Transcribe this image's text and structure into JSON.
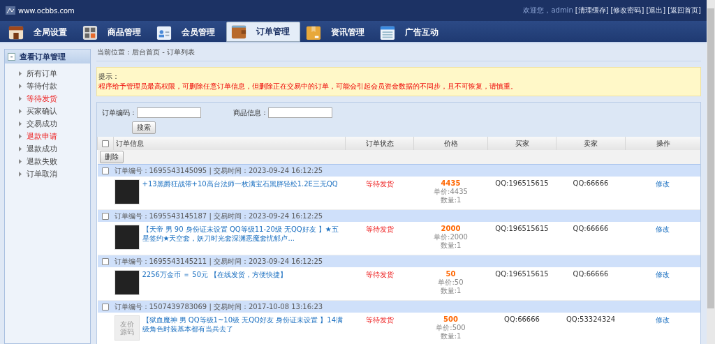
{
  "header": {
    "site": "www.ocbbs.com",
    "welcome": "欢迎您，admin",
    "links": [
      "[清理缓存]",
      "[修改密码]",
      "[退出]",
      "[返回首页]"
    ]
  },
  "tabs": [
    {
      "label": "全局设置",
      "selected": false
    },
    {
      "label": "商品管理",
      "selected": false
    },
    {
      "label": "会员管理",
      "selected": false
    },
    {
      "label": "订单管理",
      "selected": true
    },
    {
      "label": "资讯管理",
      "selected": false
    },
    {
      "label": "广告互动",
      "selected": false
    }
  ],
  "sidebar": {
    "title": "查看订单管理",
    "toggle": "-",
    "items": [
      {
        "label": "所有订单",
        "highlight": false
      },
      {
        "label": "等待付款",
        "highlight": false
      },
      {
        "label": "等待发货",
        "highlight": true
      },
      {
        "label": "买家确认",
        "highlight": false
      },
      {
        "label": "交易成功",
        "highlight": false
      },
      {
        "label": "退款申请",
        "highlight": true
      },
      {
        "label": "退款成功",
        "highlight": false
      },
      {
        "label": "退款失败",
        "highlight": false
      },
      {
        "label": "订单取消",
        "highlight": false
      }
    ]
  },
  "breadcrumb": "当前位置：后台首页 - 订单列表",
  "notice": {
    "title": "提示：",
    "text": "程序给予管理员最高权限，可删除任意订单信息，但删除正在交易中的订单，可能会引起会员资金数据的不同步，且不可恢复，请慎重。"
  },
  "search": {
    "fields": [
      {
        "label": "订单编码："
      },
      {
        "label": "商品信息："
      }
    ],
    "button": "搜索"
  },
  "table": {
    "select_all_checked": false,
    "columns": [
      "订单信息",
      "订单状态",
      "价格",
      "买家",
      "卖家",
      "操作"
    ],
    "delete_button": "删除",
    "rows": [
      {
        "header": "订单编号：1695543145095 | 交易时间：2023-09-24 16:12:25",
        "checked": false,
        "kind": "photo",
        "title": "+13黑爵狂战带+10高台法师一枚满宝石黑胖轻松1.2E三无QQ",
        "status": "等待发货",
        "price": "4435",
        "unit": "单价:4435",
        "qty": "数量:1",
        "buyer": "QQ:196515615",
        "seller": "QQ:66666",
        "action": "修改"
      },
      {
        "header": "订单编号：1695543145187 | 交易时间：2023-09-24 16:12:25",
        "checked": false,
        "kind": "photo",
        "title": "【天帝 男 90 身份证未设置 QQ等级11-20级 无QQ好友 】★五星签约★天空套，妖刀时光套深渊恶魔套忧郁卢...",
        "status": "等待发货",
        "price": "2000",
        "unit": "单价:2000",
        "qty": "数量:1",
        "buyer": "QQ:196515615",
        "seller": "QQ:66666",
        "action": "修改"
      },
      {
        "header": "订单编号：1695543145211 | 交易时间：2023-09-24 16:12:25",
        "checked": false,
        "kind": "photo",
        "title": "2256万金币 ＝ 50元 【在线发货，方便快捷】",
        "status": "等待发货",
        "price": "50",
        "unit": "单价:50",
        "qty": "数量:1",
        "buyer": "QQ:196515615",
        "seller": "QQ:66666",
        "action": "修改"
      },
      {
        "header": "订单编号：1507439783069 | 交易时间：2017-10-08 13:16:23",
        "checked": false,
        "kind": "placeholder",
        "thumb_text": "友价源码",
        "title": "【狱血魔神 男 QQ等级1~10级 无QQ好友 身份证未设置 】14满级角色时装基本都有当兵去了",
        "status": "等待发货",
        "price": "500",
        "unit": "单价:500",
        "qty": "数量:1",
        "buyer": "QQ:66666",
        "seller": "QQ:53324324",
        "action": "修改"
      }
    ]
  }
}
